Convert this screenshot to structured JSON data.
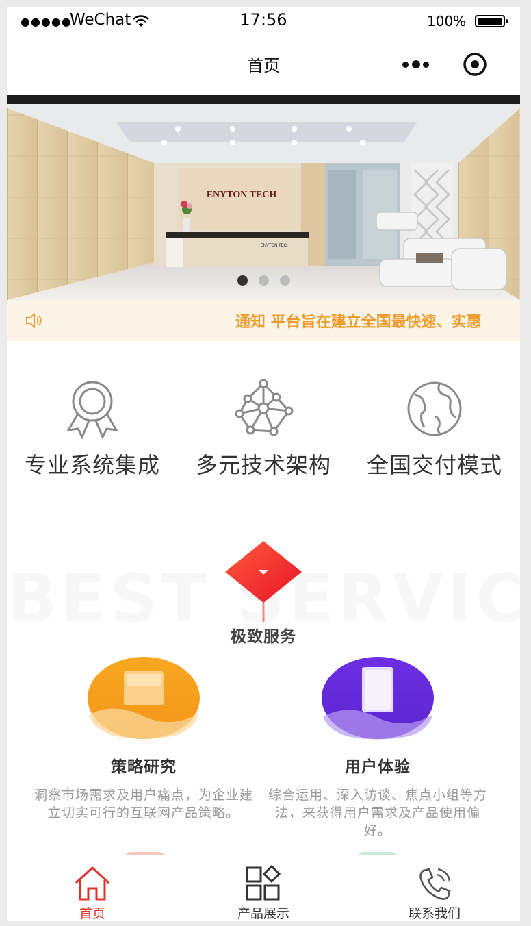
{
  "status_bar": {
    "signal": "●●●●●",
    "carrier": "WeChat",
    "time": "17:56",
    "battery": "100%"
  },
  "nav": {
    "title": "首页",
    "more_icon": "more-dots-icon",
    "target_icon": "target-icon"
  },
  "banner": {
    "sign_text": "ENYTON TECH",
    "desk_text": "ENYTON TECH",
    "slide_count": 3,
    "active_slide": 1
  },
  "notice": {
    "icon": "speaker-icon",
    "text": "通知 平台旨在建立全国最快速、实惠"
  },
  "features": [
    {
      "label": "专业系统集成",
      "icon": "award-ribbon-icon"
    },
    {
      "label": "多元技术架构",
      "icon": "network-nodes-icon"
    },
    {
      "label": "全国交付模式",
      "icon": "globe-icon"
    }
  ],
  "service": {
    "background_word": "BEST SERVICE",
    "title": "极致服务",
    "items": [
      {
        "name": "策略研究",
        "desc": "洞察市场需求及用户痛点，为企业建立切实可行的互联网产品策略。",
        "color": "#f5a31e"
      },
      {
        "name": "用户体验",
        "desc": "综合运用、深入访谈、焦点小组等方法，来获得用户需求及产品使用偏好。",
        "color": "#6a2fe0"
      }
    ]
  },
  "tabbar": {
    "active_color": "#e0332a",
    "items": [
      {
        "label": "首页",
        "icon": "home-icon",
        "active": true
      },
      {
        "label": "产品展示",
        "icon": "grid-apps-icon",
        "active": false
      },
      {
        "label": "联系我们",
        "icon": "phone-icon",
        "active": false
      }
    ]
  }
}
